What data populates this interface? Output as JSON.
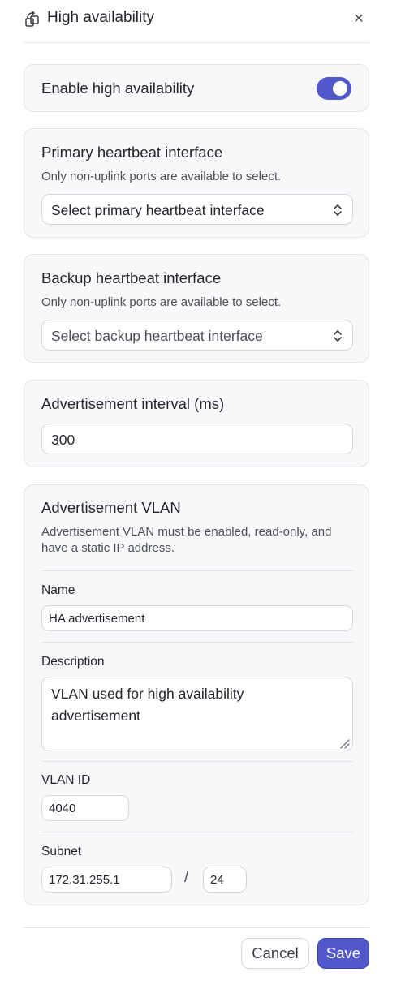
{
  "panel": {
    "title": "High availability",
    "close_icon": "close-icon",
    "title_icon": "failover-icon"
  },
  "enable_card": {
    "label": "Enable high availability",
    "toggle_on": true
  },
  "primary_card": {
    "title": "Primary heartbeat interface",
    "help": "Only non-uplink ports are available to select.",
    "select_value": "Select primary heartbeat interface"
  },
  "backup_card": {
    "title": "Backup heartbeat interface",
    "help": "Only non-uplink ports are available to select.",
    "select_value": "Select backup heartbeat interface"
  },
  "interval_card": {
    "title": "Advertisement interval (ms)",
    "value": "300"
  },
  "vlan_card": {
    "title": "Advertisement VLAN",
    "help": "Advertisement VLAN must be enabled, read-only, and have a static IP address.",
    "name_label": "Name",
    "name_value": "HA advertisement",
    "description_label": "Description",
    "description_value": "VLAN used for high availability advertisement",
    "vlan_id_label": "VLAN ID",
    "vlan_id_value": "4040",
    "subnet_label": "Subnet",
    "subnet_ip": "172.31.255.1",
    "subnet_separator": "/",
    "subnet_prefix": "24"
  },
  "footer": {
    "cancel_label": "Cancel",
    "save_label": "Save"
  },
  "colors": {
    "accent": "#5058cc",
    "card_bg": "#f8f8fa",
    "border": "#e4e5ea"
  }
}
